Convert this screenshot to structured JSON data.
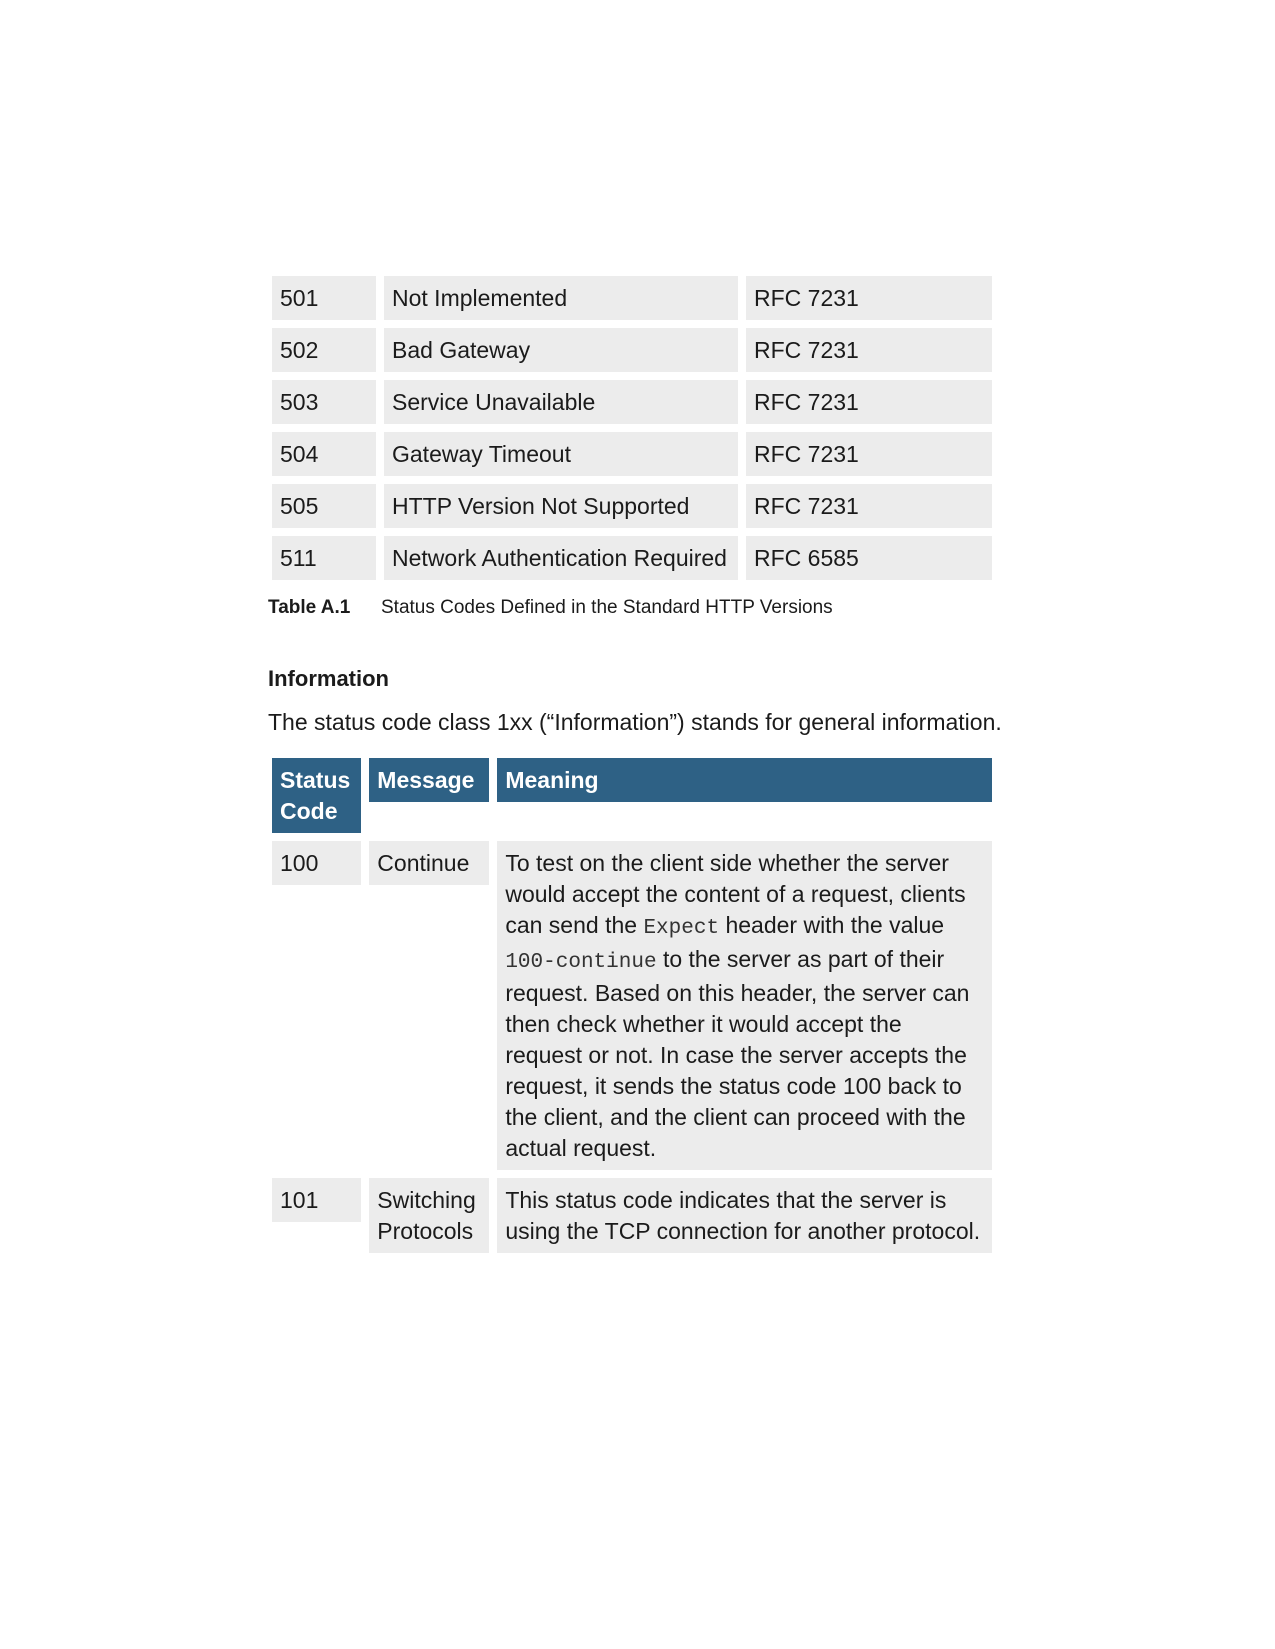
{
  "table_a1": {
    "rows": [
      {
        "code": "501",
        "message": "Not Implemented",
        "spec": "RFC 7231"
      },
      {
        "code": "502",
        "message": "Bad Gateway",
        "spec": "RFC 7231"
      },
      {
        "code": "503",
        "message": "Service Unavailable",
        "spec": "RFC 7231"
      },
      {
        "code": "504",
        "message": "Gateway Timeout",
        "spec": "RFC 7231"
      },
      {
        "code": "505",
        "message": "HTTP Version Not Supported",
        "spec": "RFC 7231"
      },
      {
        "code": "511",
        "message": "Network Authentication Required",
        "spec": "RFC 6585"
      }
    ],
    "caption_label": "Table A.1",
    "caption_text": "Status Codes Defined in the Standard HTTP Versions"
  },
  "section": {
    "heading": "Information",
    "body": "The status code class 1xx (“Information”) stands for general information."
  },
  "info_table": {
    "headers": {
      "code": "Status Code",
      "message": "Message",
      "meaning": "Meaning"
    },
    "row_100": {
      "code": "100",
      "message": "Continue",
      "meaning_1": "To test on the client side whether the server would accept the content of a request, clients can send the ",
      "meaning_code1": "Expect",
      "meaning_2": " header with the value ",
      "meaning_code2": "100-continue",
      "meaning_3": " to the server as part of their request. Based on this header, the server can then check whether it would accept the request or not. In case the server accepts the request, it sends the status code 100 back to the client, and the client can proceed with the actual request."
    },
    "row_101": {
      "code": "101",
      "message": "Switching Protocols",
      "meaning": "This status code indicates that the server is using the TCP connection for another protocol."
    }
  }
}
